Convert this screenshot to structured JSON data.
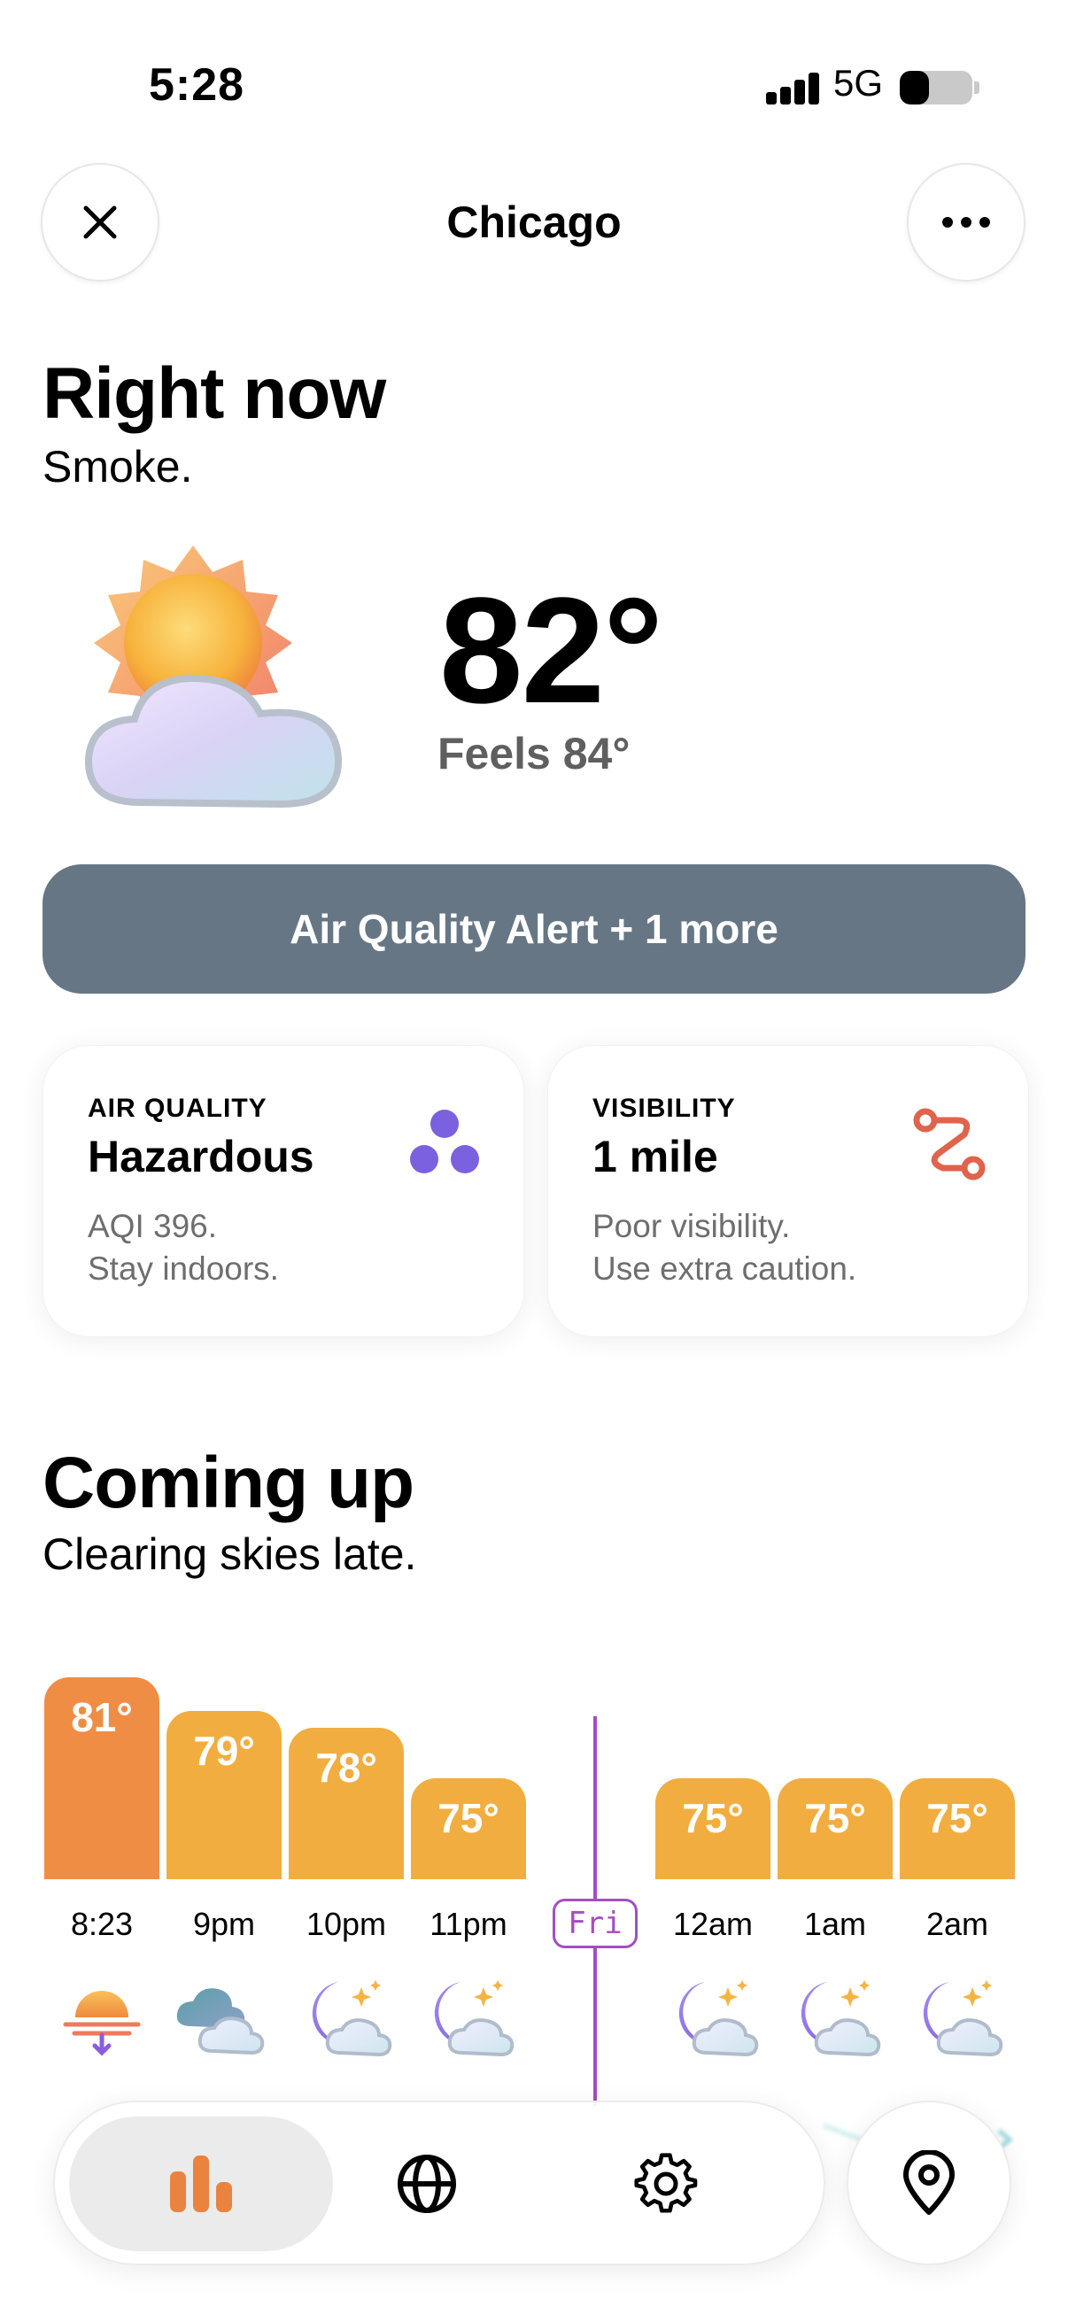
{
  "status_bar": {
    "time": "5:28",
    "network": "5G",
    "battery_level": 0.4
  },
  "header": {
    "city": "Chicago",
    "close_icon": "close-icon",
    "more_icon": "more-icon"
  },
  "right_now": {
    "title": "Right now",
    "condition": "Smoke.",
    "icon": "partly-cloudy-day-icon",
    "temperature": "82°",
    "feels_like": "Feels 84°"
  },
  "alert": {
    "label": "Air Quality Alert + 1 more"
  },
  "cards": {
    "air_quality": {
      "label": "AIR QUALITY",
      "value": "Hazardous",
      "line1": "AQI 396.",
      "line2": "Stay indoors.",
      "icon": "air-quality-dots-icon",
      "color": "#7b61e0"
    },
    "visibility": {
      "label": "VISIBILITY",
      "value": "1 mile",
      "line1": "Poor visibility.",
      "line2": "Use extra caution.",
      "icon": "route-icon",
      "color": "#e0634c"
    }
  },
  "coming_up": {
    "title": "Coming up",
    "summary": "Clearing skies late.",
    "day_marker": "Fri",
    "hours": [
      {
        "time": "8:23",
        "temp": "81°",
        "temp_value": 81,
        "icon": "sunset-icon",
        "color": "#ef8d45"
      },
      {
        "time": "9pm",
        "temp": "79°",
        "temp_value": 79,
        "icon": "cloudy-night-icon",
        "color": "#f2ad40"
      },
      {
        "time": "10pm",
        "temp": "78°",
        "temp_value": 78,
        "icon": "moon-cloud-icon",
        "color": "#f2ad40"
      },
      {
        "time": "11pm",
        "temp": "75°",
        "temp_value": 75,
        "icon": "moon-cloud-icon",
        "color": "#f2ad40"
      },
      {
        "time": "12am",
        "temp": "75°",
        "temp_value": 75,
        "icon": "moon-cloud-icon",
        "color": "#f2ad40"
      },
      {
        "time": "1am",
        "temp": "75°",
        "temp_value": 75,
        "icon": "moon-cloud-icon",
        "color": "#f2ad40"
      },
      {
        "time": "2am",
        "temp": "75°",
        "temp_value": 75,
        "icon": "moon-cloud-icon",
        "color": "#f2ad40"
      }
    ]
  },
  "bottom_nav": {
    "items": [
      {
        "icon": "forecast-bars-icon",
        "active": true
      },
      {
        "icon": "globe-icon",
        "active": false
      },
      {
        "icon": "gear-icon",
        "active": false
      }
    ],
    "location_icon": "location-pin-icon"
  }
}
